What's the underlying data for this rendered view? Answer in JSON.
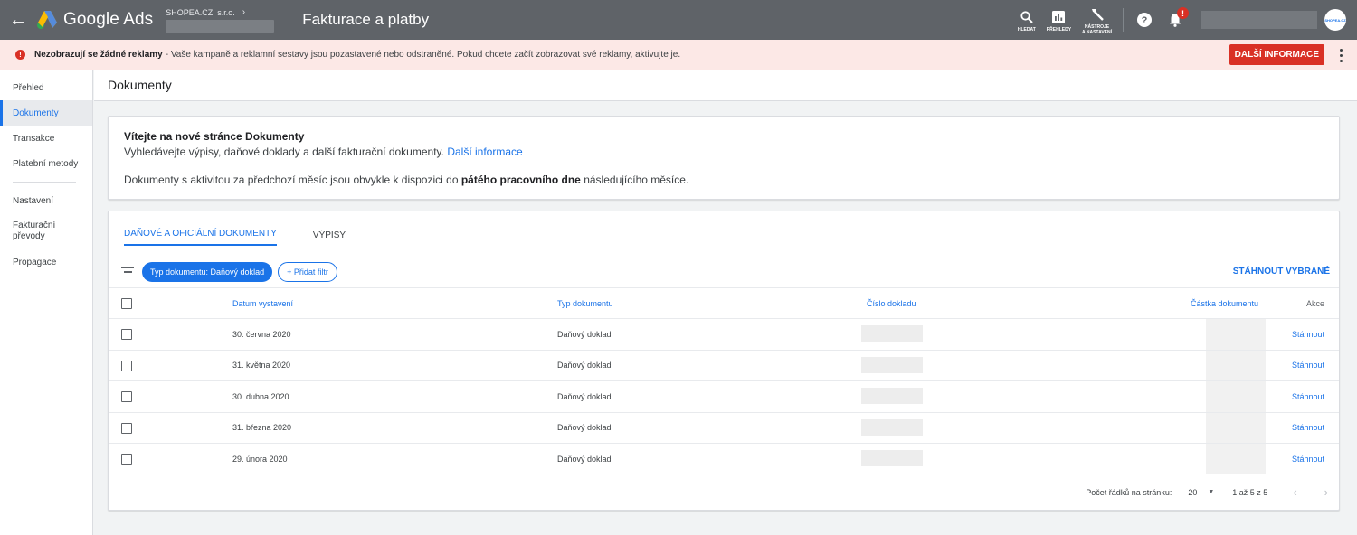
{
  "topbar": {
    "product": "Google Ads",
    "account_name": "SHOPEA.CZ, s.r.o.",
    "page_title": "Fakturace a platby",
    "tools": [
      {
        "icon": "search-icon",
        "label": "HLEDAT"
      },
      {
        "icon": "reports-icon",
        "label": "PŘEHLEDY"
      },
      {
        "icon": "wrench-icon",
        "label_line1": "NÁSTROJE",
        "label_line2": "A NASTAVENÍ"
      }
    ],
    "notification_badge": "!",
    "avatar_text": "SHOPEA.CZ"
  },
  "alert": {
    "bold": "Nezobrazují se žádné reklamy",
    "text": "- Vaše kampaně a reklamní sestavy jsou pozastavené nebo odstraněné. Pokud chcete začít zobrazovat své reklamy, aktivujte je.",
    "button": "DALŠÍ INFORMACE",
    "colors": {
      "background": "#fce8e6",
      "button": "#d93025"
    }
  },
  "sidebar": {
    "items": [
      {
        "label": "Přehled"
      },
      {
        "label": "Dokumenty",
        "active": true
      },
      {
        "label": "Transakce"
      },
      {
        "label": "Platební metody"
      },
      {
        "label": "Nastavení"
      },
      {
        "label_line1": "Fakturační",
        "label_line2": "převody"
      },
      {
        "label": "Propagace"
      }
    ]
  },
  "main": {
    "header": "Dokumenty",
    "welcome": {
      "title": "Vítejte na nové stránce Dokumenty",
      "line1": "Vyhledávejte výpisy, daňové doklady a další fakturační dokumenty.",
      "line1_link": "Další informace",
      "line2_pre": "Dokumenty s aktivitou za předchozí měsíc jsou obvykle k dispozici do",
      "line2_bold": "pátého pracovního dne",
      "line2_post": "následujícího měsíce."
    },
    "tabs": [
      {
        "label": "DAŇOVÉ A OFICIÁLNÍ DOKUMENTY",
        "active": true
      },
      {
        "label": "VÝPISY"
      }
    ],
    "filter_chip": "Typ dokumentu: Daňový doklad",
    "add_filter": "+ Přidat filtr",
    "download_selected": "STÁHNOUT VYBRANÉ",
    "table": {
      "headers": {
        "date": "Datum vystavení",
        "type": "Typ dokumentu",
        "number": "Číslo dokladu",
        "amount": "Částka dokumentu",
        "action": "Akce"
      },
      "rows": [
        {
          "date": "30. června 2020",
          "type": "Daňový doklad",
          "action": "Stáhnout"
        },
        {
          "date": "31. května 2020",
          "type": "Daňový doklad",
          "action": "Stáhnout"
        },
        {
          "date": "30. dubna 2020",
          "type": "Daňový doklad",
          "action": "Stáhnout"
        },
        {
          "date": "31. března 2020",
          "type": "Daňový doklad",
          "action": "Stáhnout"
        },
        {
          "date": "29. února 2020",
          "type": "Daňový doklad",
          "action": "Stáhnout"
        }
      ]
    },
    "pager": {
      "rows_label": "Počet řádků na stránku:",
      "rows_value": "20",
      "range": "1 až 5 z 5"
    }
  },
  "colors": {
    "topbar": "#5f6368",
    "accent": "#1a73e8"
  }
}
